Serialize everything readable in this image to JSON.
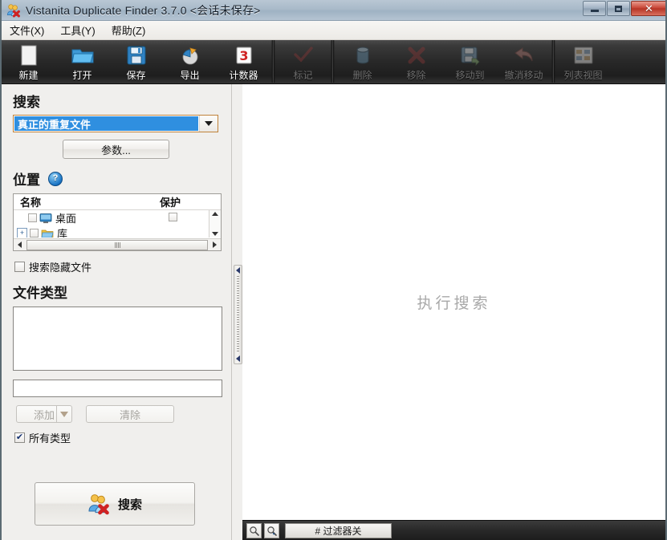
{
  "window": {
    "title": "Vistanita Duplicate Finder 3.7.0 <会话未保存>",
    "icon": "duplicate-finder-icon",
    "controls": {
      "minimize": "minimize-icon",
      "maximize": "maximize-icon",
      "close": "✕"
    }
  },
  "menubar": {
    "items": [
      {
        "label": "文件(X)",
        "name": "menu-file"
      },
      {
        "label": "工具(Y)",
        "name": "menu-tools"
      },
      {
        "label": "帮助(Z)",
        "name": "menu-help"
      }
    ]
  },
  "toolbar": {
    "buttons": [
      {
        "label": "新建",
        "icon": "new-document-icon",
        "enabled": true
      },
      {
        "label": "打开",
        "icon": "open-folder-icon",
        "enabled": true
      },
      {
        "label": "保存",
        "icon": "save-floppy-icon",
        "enabled": true
      },
      {
        "label": "导出",
        "icon": "export-pie-chart-icon",
        "enabled": true
      },
      {
        "label": "计数器",
        "icon": "counter-calendar-icon",
        "enabled": true
      },
      {
        "label": "标记",
        "icon": "checkmark-icon",
        "enabled": false
      },
      {
        "label": "删除",
        "icon": "delete-cylinder-icon",
        "enabled": false
      },
      {
        "label": "移除",
        "icon": "remove-red-x-icon",
        "enabled": false
      },
      {
        "label": "移动到",
        "icon": "move-to-floppy-icon",
        "enabled": false
      },
      {
        "label": "撤消移动",
        "icon": "undo-arrow-icon",
        "enabled": false
      },
      {
        "label": "列表视图",
        "icon": "list-view-grid-icon",
        "enabled": false
      }
    ]
  },
  "sidebar": {
    "search": {
      "heading": "搜索",
      "selected_mode": "真正的重复文件",
      "dropdown_icon": "chevron-down-icon",
      "params_button": "参数..."
    },
    "location": {
      "heading": "位置",
      "help_icon": "?",
      "columns": {
        "name": "名称",
        "protect": "保护"
      },
      "rows": [
        {
          "label": "桌面",
          "icon": "desktop-icon",
          "expandable": false,
          "protected": false
        },
        {
          "label": "库",
          "icon": "library-folder-icon",
          "expandable": true,
          "protected": false
        }
      ]
    },
    "hidden_files": {
      "label": "搜索隐藏文件",
      "checked": false
    },
    "file_types": {
      "heading": "文件类型",
      "list_value": "",
      "input_value": "",
      "input_placeholder": "",
      "add_button": "添加",
      "add_dropdown_icon": "chevron-down-icon",
      "clear_button": "清除",
      "all_types": {
        "label": "所有类型",
        "checked": true
      }
    },
    "search_button": {
      "label": "搜索",
      "icon": "duplicate-finder-icon"
    }
  },
  "main": {
    "placeholder": "执行搜索"
  },
  "statusbar": {
    "zoom_in_icon": "magnifier-plus-icon",
    "zoom_out_icon": "magnifier-minus-icon",
    "filter_text": "# 过滤器关"
  },
  "splitter": {
    "collapse_up_icon": "collapse-left-icon",
    "collapse_down_icon": "collapse-left-icon"
  },
  "colors": {
    "selection_blue": "#2f8fe0",
    "focus_orange": "#c0823a",
    "close_red": "#c9493a",
    "toolbar_dark": "#282828"
  }
}
